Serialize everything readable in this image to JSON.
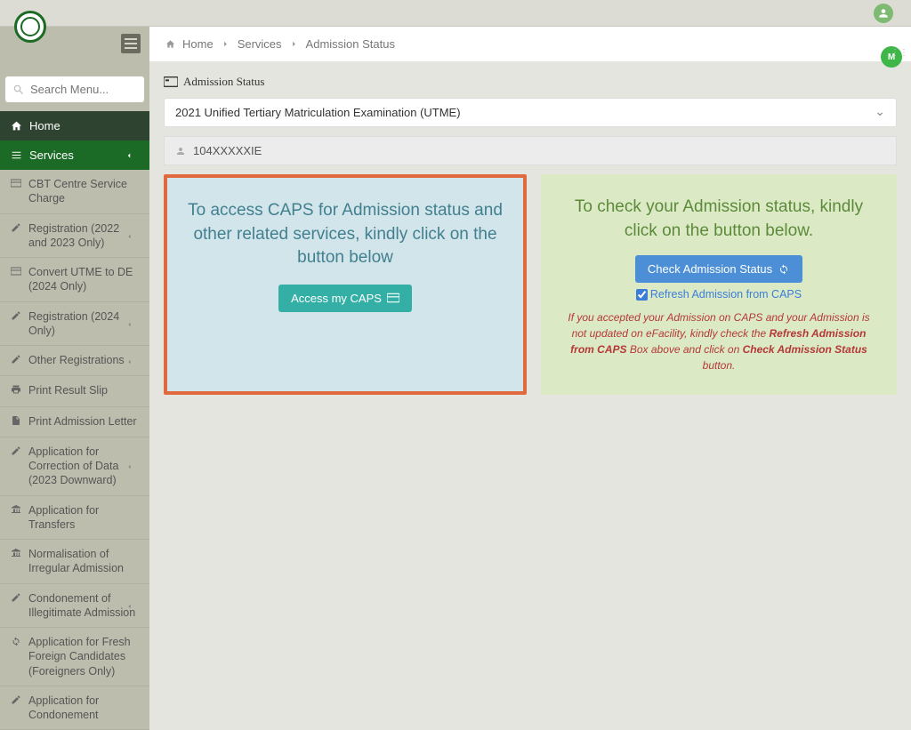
{
  "header": {},
  "sidebar": {
    "search_placeholder": "Search Menu...",
    "home_label": "Home",
    "services_label": "Services",
    "items": [
      {
        "label": "CBT Centre Service Charge",
        "icon": "card",
        "chev": false
      },
      {
        "label": "Registration (2022 and 2023 Only)",
        "icon": "edit",
        "chev": true
      },
      {
        "label": "Convert UTME to DE (2024 Only)",
        "icon": "card",
        "chev": false
      },
      {
        "label": "Registration (2024 Only)",
        "icon": "edit",
        "chev": true
      },
      {
        "label": "Other Registrations",
        "icon": "edit",
        "chev": true
      },
      {
        "label": "Print Result Slip",
        "icon": "print",
        "chev": false
      },
      {
        "label": "Print Admission Letter",
        "icon": "doc",
        "chev": false
      },
      {
        "label": "Application for Correction of Data (2023 Downward)",
        "icon": "edit",
        "chev": true
      },
      {
        "label": "Application for Transfers",
        "icon": "bank",
        "chev": false
      },
      {
        "label": "Normalisation of Irregular Admission",
        "icon": "bank",
        "chev": false
      },
      {
        "label": "Condonement of Illegitimate Admission",
        "icon": "edit",
        "chev": true
      },
      {
        "label": "Application for Fresh Foreign Candidates (Foreigners Only)",
        "icon": "recycle",
        "chev": false
      },
      {
        "label": "Application for Condonement",
        "icon": "edit",
        "chev": false
      }
    ]
  },
  "breadcrumb": {
    "home": "Home",
    "services": "Services",
    "current": "Admission Status"
  },
  "page": {
    "title": "Admission Status",
    "exam_selected": "2021 Unified Tertiary Matriculation Examination (UTME)",
    "reg_number": "104XXXXXIE"
  },
  "caps_panel": {
    "text": "To access CAPS for Admission status and other related services, kindly click on the button below",
    "button": "Access my CAPS"
  },
  "check_panel": {
    "text": "To check your Admission status, kindly click on the button below.",
    "button": "Check Admission Status",
    "refresh_label": "Refresh Admission from CAPS",
    "notice_pre": "If you accepted your Admission on CAPS and your Admission is not updated on eFacility, kindly check the ",
    "notice_bold1": "Refresh Admission from CAPS",
    "notice_mid": " Box above and click on ",
    "notice_bold2": "Check Admission Status",
    "notice_post": " button."
  },
  "float_badge": "M"
}
